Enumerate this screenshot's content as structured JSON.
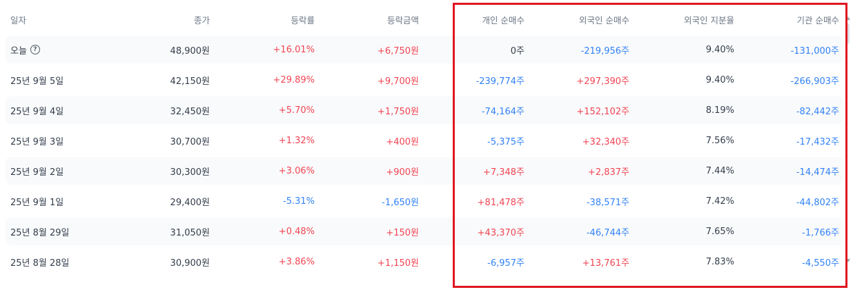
{
  "headers": [
    "일자",
    "종가",
    "등락률",
    "등락금액",
    "개인 순매수",
    "외국인 순매수",
    "외국인 지분율",
    "기관 순매수"
  ],
  "info_icon_glyph": "?",
  "colors": {
    "up": "#f04452",
    "down": "#3182f6",
    "neutral": "#333d4b",
    "highlight": "#e0161f"
  },
  "rows": [
    {
      "date": "오늘",
      "close": "48,900원",
      "rate": "+16.01%",
      "amount": "+6,750원",
      "individual": "0주",
      "foreign": "-219,956주",
      "foreign_ratio": "9.40%",
      "institution": "-131,000주"
    },
    {
      "date": "25년 9월 5일",
      "close": "42,150원",
      "rate": "+29.89%",
      "amount": "+9,700원",
      "individual": "-239,774주",
      "foreign": "+297,390주",
      "foreign_ratio": "9.40%",
      "institution": "-266,903주"
    },
    {
      "date": "25년 9월 4일",
      "close": "32,450원",
      "rate": "+5.70%",
      "amount": "+1,750원",
      "individual": "-74,164주",
      "foreign": "+152,102주",
      "foreign_ratio": "8.19%",
      "institution": "-82,442주"
    },
    {
      "date": "25년 9월 3일",
      "close": "30,700원",
      "rate": "+1.32%",
      "amount": "+400원",
      "individual": "-5,375주",
      "foreign": "+32,340주",
      "foreign_ratio": "7.56%",
      "institution": "-17,432주"
    },
    {
      "date": "25년 9월 2일",
      "close": "30,300원",
      "rate": "+3.06%",
      "amount": "+900원",
      "individual": "+7,348주",
      "foreign": "+2,837주",
      "foreign_ratio": "7.44%",
      "institution": "-14,474주"
    },
    {
      "date": "25년 9월 1일",
      "close": "29,400원",
      "rate": "-5.31%",
      "amount": "-1,650원",
      "individual": "+81,478주",
      "foreign": "-38,571주",
      "foreign_ratio": "7.42%",
      "institution": "-44,802주"
    },
    {
      "date": "25년 8월 29일",
      "close": "31,050원",
      "rate": "+0.48%",
      "amount": "+150원",
      "individual": "+43,370주",
      "foreign": "-46,744주",
      "foreign_ratio": "7.65%",
      "institution": "-1,766주"
    },
    {
      "date": "25년 8월 28일",
      "close": "30,900원",
      "rate": "+3.86%",
      "amount": "+1,150원",
      "individual": "-6,957주",
      "foreign": "+13,761주",
      "foreign_ratio": "7.83%",
      "institution": "-4,550주"
    }
  ]
}
